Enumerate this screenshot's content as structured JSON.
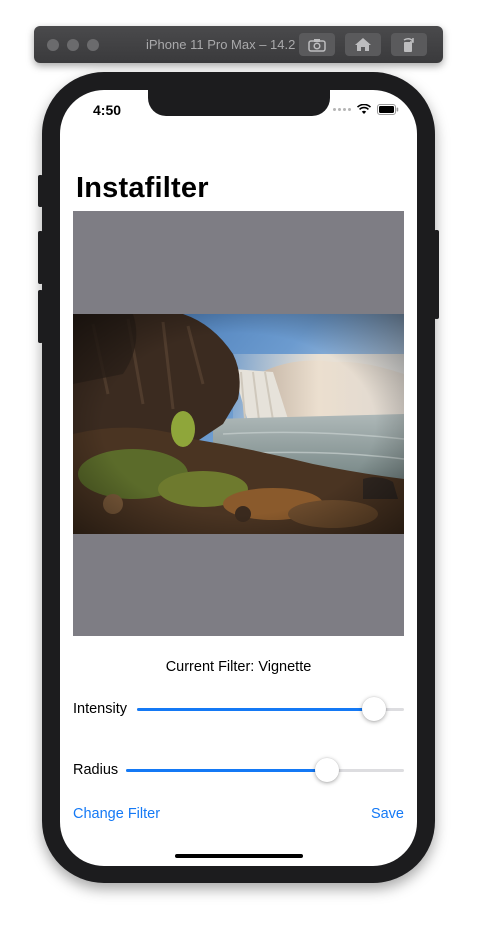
{
  "simulator": {
    "title": "iPhone 11 Pro Max – 14.2",
    "toolbar_icons": [
      "camera-icon",
      "home-icon",
      "rotate-icon"
    ]
  },
  "status_bar": {
    "time": "4:50",
    "icons": [
      "signal-dots-icon",
      "wifi-icon",
      "battery-icon"
    ]
  },
  "app": {
    "title": "Instafilter",
    "current_filter_label": "Current Filter: Vignette",
    "sliders": {
      "intensity": {
        "label": "Intensity",
        "value": 0.88
      },
      "radius": {
        "label": "Radius",
        "value": 0.73
      }
    },
    "change_filter_label": "Change Filter",
    "save_label": "Save"
  },
  "colors": {
    "accent": "#1479f5",
    "image_background": "#7e7d84",
    "device_frame": "#1c1c1e"
  }
}
